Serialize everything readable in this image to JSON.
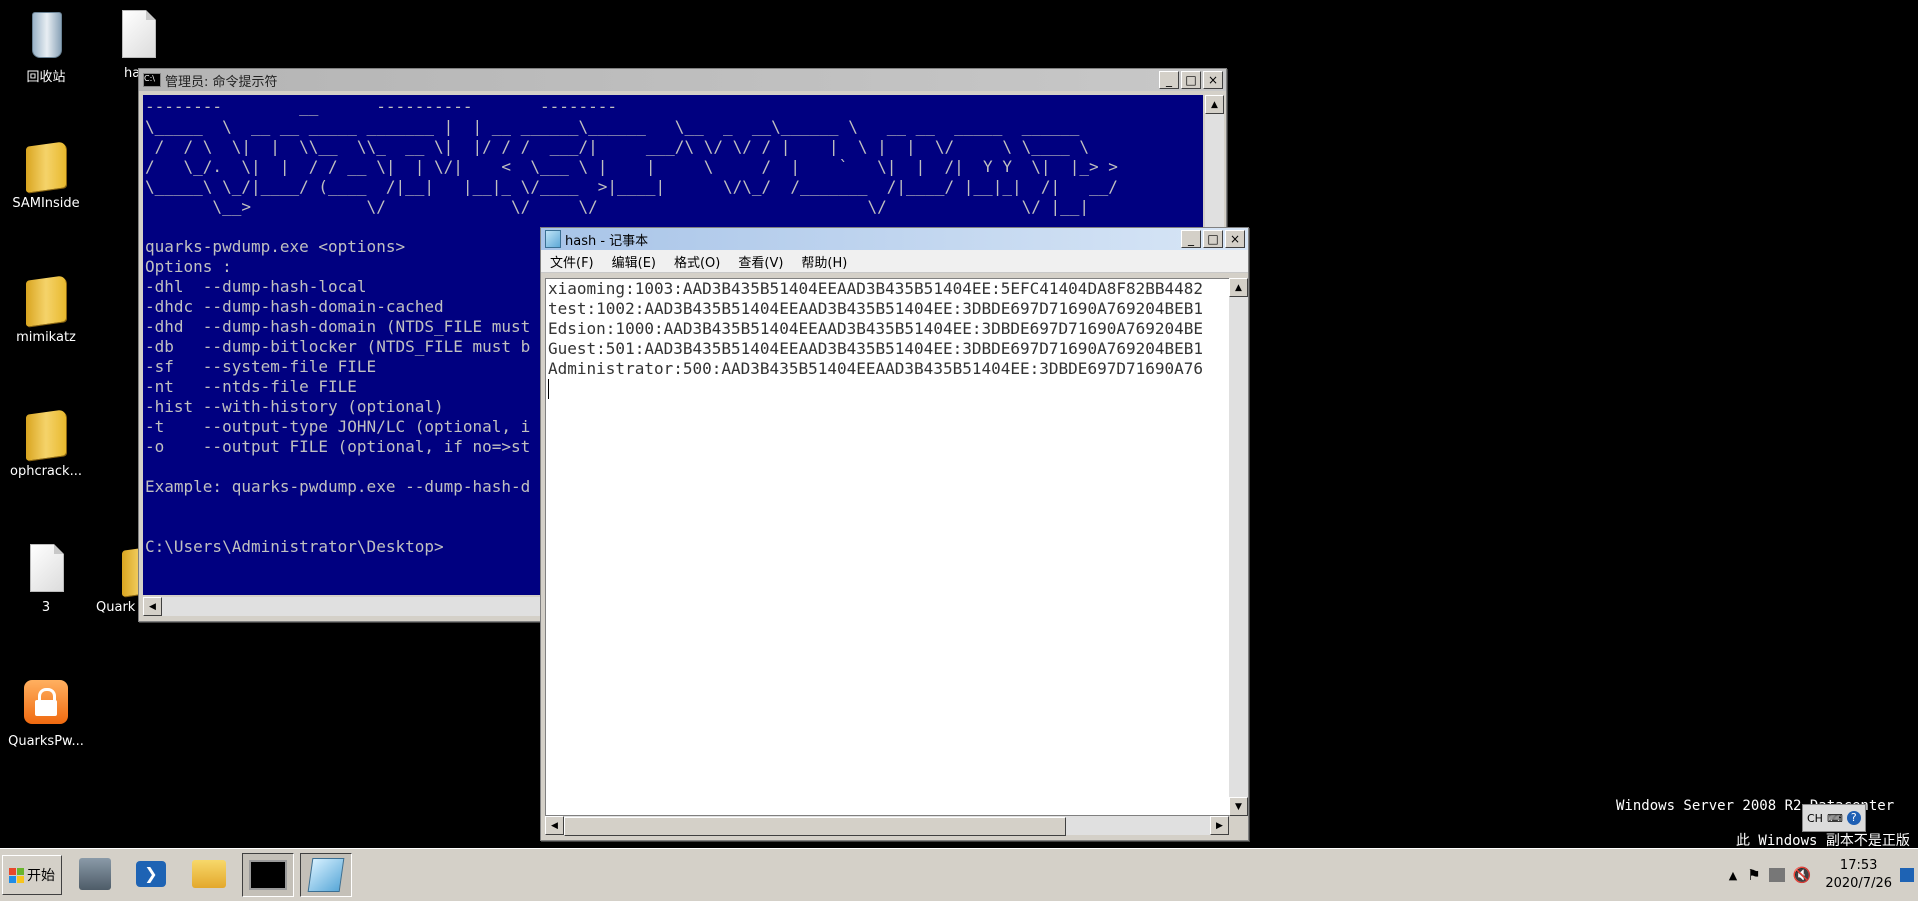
{
  "desktop": {
    "icons": [
      {
        "label": "回收站"
      },
      {
        "label": "ha"
      },
      {
        "label": "SAMInside"
      },
      {
        "label": "mimikatz"
      },
      {
        "label": "ophcrack..."
      },
      {
        "label": "3"
      },
      {
        "label": "Quark"
      },
      {
        "label": "QuarksPw..."
      }
    ]
  },
  "cmd_window": {
    "title": "管理员: 命令提示符",
    "output_lines": [
      "--------        __      ----------       --------",
      "\\_____  \\  __ __ _____ _______ |  | __ ______\\______   \\__  _  __\\______ \\   __ __  _____  ______",
      " /  / \\  \\|  |  \\\\__  \\\\_  __ \\|  |/ / /  ___/|     ___/\\ \\/ \\/ / |    |  \\ |  |  \\/     \\ \\____ \\",
      "/   \\_/.  \\|  |  / / __ \\|  | \\/|    <  \\___ \\ |    |     \\     /  |    `   \\|  |  /|  Y Y  \\|  |_> >",
      "\\_____\\ \\_/|____/ (____  /|__|   |__|_ \\/____  >|____|      \\/\\_/  /_______  /|____/ |__|_|  /|   __/",
      "       \\__>            \\/             \\/     \\/                            \\/              \\/ |__|",
      "",
      "quarks-pwdump.exe <options>",
      "Options :",
      "-dhl  --dump-hash-local",
      "-dhdc --dump-hash-domain-cached",
      "-dhd  --dump-hash-domain (NTDS_FILE must",
      "-db   --dump-bitlocker (NTDS_FILE must b",
      "-sf   --system-file FILE",
      "-nt   --ntds-file FILE",
      "-hist --with-history (optional)",
      "-t    --output-type JOHN/LC (optional, i",
      "-o    --output FILE (optional, if no=>st",
      "",
      "Example: quarks-pwdump.exe --dump-hash-d",
      "",
      "",
      "C:\\Users\\Administrator\\Desktop>"
    ]
  },
  "notepad_window": {
    "title": "hash - 记事本",
    "menu": [
      "文件(F)",
      "编辑(E)",
      "格式(O)",
      "查看(V)",
      "帮助(H)"
    ],
    "lines": [
      "xiaoming:1003:AAD3B435B51404EEAAD3B435B51404EE:5EFC41404DA8F82BB4482",
      "test:1002:AAD3B435B51404EEAAD3B435B51404EE:3DBDE697D71690A769204BEB1",
      "Edsion:1000:AAD3B435B51404EEAAD3B435B51404EE:3DBDE697D71690A769204BE",
      "Guest:501:AAD3B435B51404EEAAD3B435B51404EE:3DBDE697D71690A769204BEB1",
      "Administrator:500:AAD3B435B51404EEAAD3B435B51404EE:3DBDE697D71690A76"
    ]
  },
  "watermark": {
    "line1": "Windows Server 2008 R2 Datacenter",
    "line2": "此 Windows 副本不是正版"
  },
  "langbar": {
    "lang": "CH"
  },
  "taskbar": {
    "start_label": "开始",
    "time": "17:53",
    "date": "2020/7/26"
  }
}
